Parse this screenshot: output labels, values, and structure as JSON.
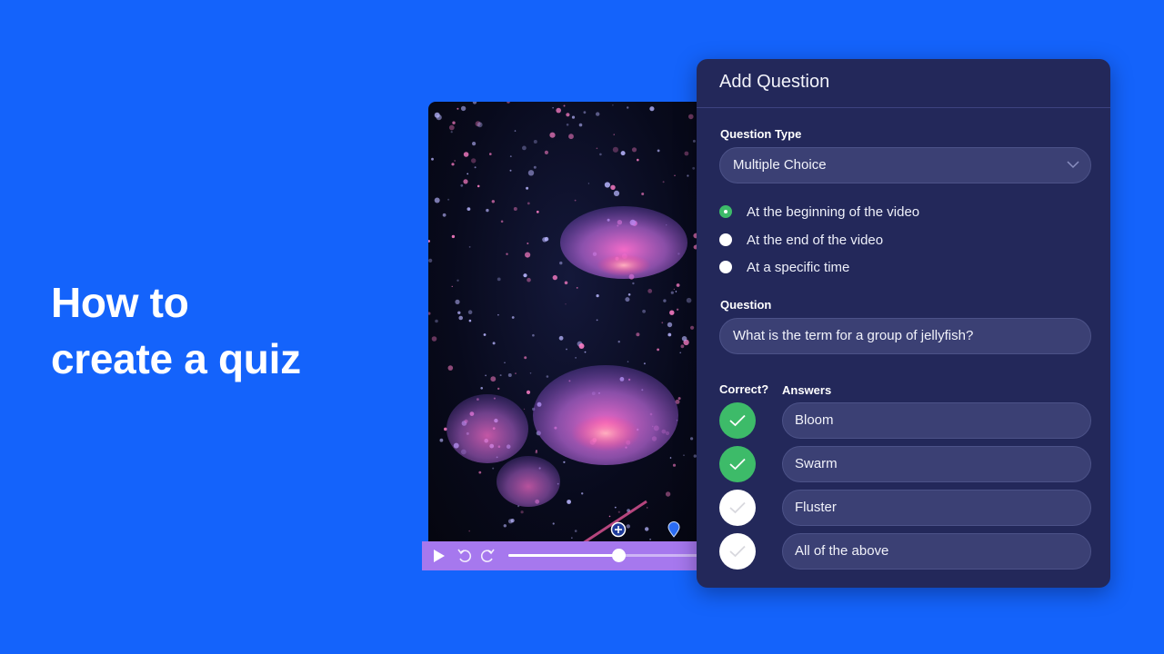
{
  "headline": {
    "line1": "How to",
    "line2": "create a quiz"
  },
  "video": {
    "progress": 0.55,
    "markers": [
      "add-question-marker",
      "question-pin-marker"
    ]
  },
  "panel": {
    "title": "Add Question",
    "question_type": {
      "label": "Question Type",
      "value": "Multiple Choice"
    },
    "timing_options": [
      {
        "label": "At the beginning of the video",
        "selected": true
      },
      {
        "label": "At the end of the video",
        "selected": false
      },
      {
        "label": "At a specific time",
        "selected": false
      }
    ],
    "question": {
      "label": "Question",
      "value": "What is the term for a group of jellyfish?"
    },
    "answers_header": {
      "correct_label": "Correct?",
      "answers_label": "Answers"
    },
    "answers": [
      {
        "text": "Bloom",
        "correct": true
      },
      {
        "text": "Swarm",
        "correct": true
      },
      {
        "text": "Fluster",
        "correct": false
      },
      {
        "text": "All of the above",
        "correct": false
      }
    ]
  },
  "colors": {
    "background": "#1463fb",
    "panel": "#23285a",
    "field": "#3b4074",
    "accent_green": "#3dbb69",
    "player_bar": "#a678ee"
  }
}
